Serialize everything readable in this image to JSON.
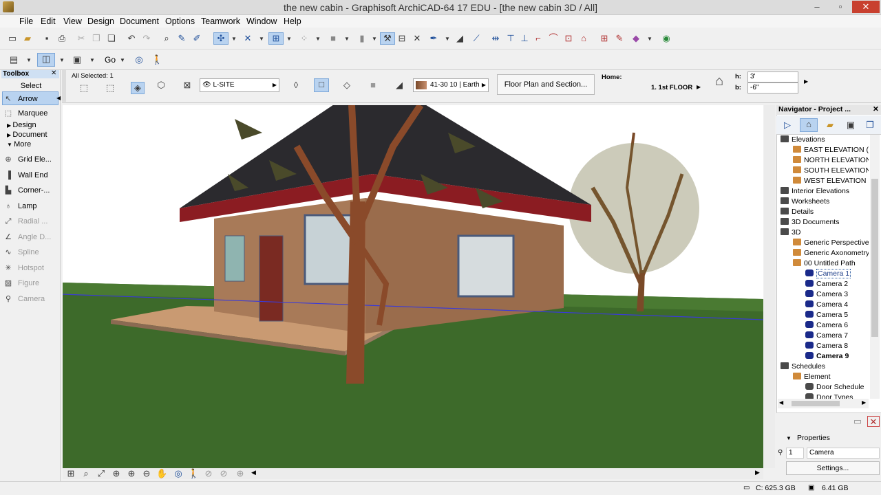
{
  "window": {
    "title": "the new cabin - Graphisoft ArchiCAD-64 17 EDU - [the new cabin 3D / All]",
    "min_glyph": "–",
    "max_glyph": "▫",
    "close_glyph": "✕"
  },
  "menu": [
    "File",
    "Edit",
    "View",
    "Design",
    "Document",
    "Options",
    "Teamwork",
    "Window",
    "Help"
  ],
  "toolbar2": {
    "go_label": "Go"
  },
  "toolbox": {
    "title": "Toolbox",
    "select_label": "Select",
    "tools_top": [
      "Arrow",
      "Marquee"
    ],
    "groups": [
      "Design",
      "Document",
      "More"
    ],
    "tools": [
      "Grid Ele...",
      "Wall End",
      "Corner-...",
      "Lamp",
      "Radial ...",
      "Angle D...",
      "Spline",
      "Hotspot",
      "Figure",
      "Camera"
    ]
  },
  "infobox": {
    "selection": "All Selected: 1",
    "layer": "L-SITE",
    "material": "41-30 10 | Earth",
    "display_button": "Floor Plan and Section...",
    "home_label": "Home:",
    "home_story": "1. 1st FLOOR",
    "h_label": "h:",
    "h_value": "3'",
    "b_label": "b:",
    "b_value": "-6\""
  },
  "navigator": {
    "title": "Navigator - Project ...",
    "items": [
      {
        "label": "Elevations",
        "level": 0
      },
      {
        "label": "EAST ELEVATION (Au",
        "level": 1
      },
      {
        "label": "NORTH ELEVATION (A",
        "level": 1
      },
      {
        "label": "SOUTH ELEVATION (A",
        "level": 1
      },
      {
        "label": "WEST ELEVATION (Au",
        "level": 1
      },
      {
        "label": "Interior Elevations",
        "level": 0
      },
      {
        "label": "Worksheets",
        "level": 0
      },
      {
        "label": "Details",
        "level": 0
      },
      {
        "label": "3D Documents",
        "level": 0
      },
      {
        "label": "3D",
        "level": 0
      },
      {
        "label": "Generic Perspective",
        "level": 1
      },
      {
        "label": "Generic Axonometry",
        "level": 1
      },
      {
        "label": "00 Untitled Path",
        "level": 1
      },
      {
        "label": "Camera 1",
        "level": 2,
        "selected": true
      },
      {
        "label": "Camera 2",
        "level": 2
      },
      {
        "label": "Camera 3",
        "level": 2
      },
      {
        "label": "Camera 4",
        "level": 2
      },
      {
        "label": "Camera 5",
        "level": 2
      },
      {
        "label": "Camera 6",
        "level": 2
      },
      {
        "label": "Camera 7",
        "level": 2
      },
      {
        "label": "Camera 8",
        "level": 2
      },
      {
        "label": "Camera 9",
        "level": 2,
        "bold": true
      },
      {
        "label": "Schedules",
        "level": 0
      },
      {
        "label": "Element",
        "level": 1
      },
      {
        "label": "Door Schedule",
        "level": 2
      },
      {
        "label": "Door Types",
        "level": 2
      }
    ]
  },
  "properties": {
    "title": "Properties",
    "id_value": "1",
    "name_value": "Camera",
    "settings_button": "Settings..."
  },
  "status": {
    "disk_c": "C: 625.3 GB",
    "memory": "6.41 GB"
  },
  "colors": {
    "accent": "#1f4f9a",
    "selection": "#b9d3f0",
    "roof": "#8b1c22",
    "wall": "#a87a58",
    "grass": "#3d6a2a"
  }
}
